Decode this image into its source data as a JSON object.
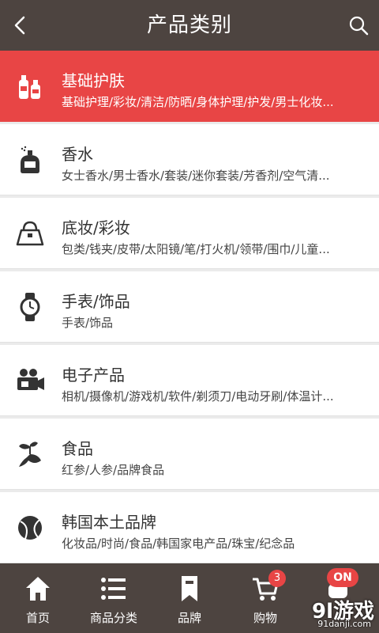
{
  "header": {
    "title": "产品类别"
  },
  "categories": [
    {
      "name": "基础护肤",
      "sub": "基础护理/彩妆/清洁/防晒/身体护理/护发/男士化妆..."
    },
    {
      "name": "香水",
      "sub": "女士香水/男士香水/套装/迷你套装/芳香剂/空气清..."
    },
    {
      "name": "底妆/彩妆",
      "sub": "包类/钱夹/皮带/太阳镜/笔/打火机/领带/围巾/儿童..."
    },
    {
      "name": "手表/饰品",
      "sub": "手表/饰品"
    },
    {
      "name": "电子产品",
      "sub": "相机/摄像机/游戏机/软件/剃须刀/电动牙刷/体温计..."
    },
    {
      "name": "食品",
      "sub": "红参/人参/品牌食品"
    },
    {
      "name": "韩国本土品牌",
      "sub": "化妆品/时尚/食品/韩国家电产品/珠宝/纪念品"
    }
  ],
  "tabs": [
    {
      "label": "首页"
    },
    {
      "label": "商品分类"
    },
    {
      "label": "品牌"
    },
    {
      "label": "购物",
      "badge": "3"
    },
    {
      "label": "",
      "toggle": "ON"
    }
  ],
  "watermark": {
    "main": "9l游戏",
    "url": "91danji.com"
  },
  "colors": {
    "accent": "#e84545",
    "bar": "#4d4440"
  }
}
